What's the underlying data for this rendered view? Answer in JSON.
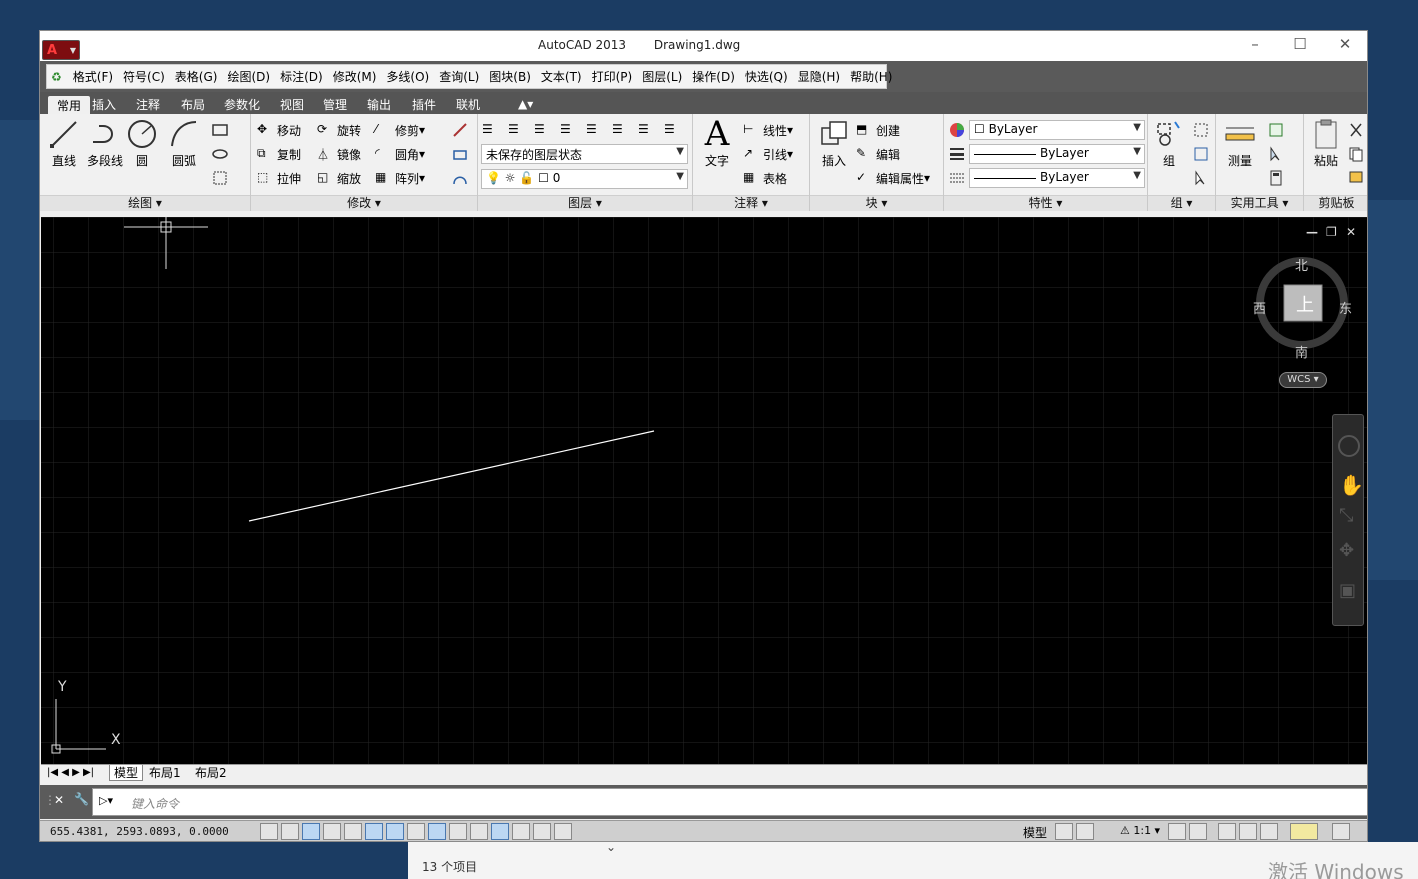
{
  "titlebar": {
    "app": "AutoCAD 2013",
    "file": "Drawing1.dwg"
  },
  "menu": [
    "格式(F)",
    "符号(C)",
    "表格(G)",
    "绘图(D)",
    "标注(D)",
    "修改(M)",
    "多线(O)",
    "查询(L)",
    "图块(B)",
    "文本(T)",
    "打印(P)",
    "图层(L)",
    "操作(D)",
    "快选(Q)",
    "显隐(H)",
    "帮助(H)"
  ],
  "tabs": [
    "常用",
    "插入",
    "注释",
    "布局",
    "参数化",
    "视图",
    "管理",
    "输出",
    "插件",
    "联机"
  ],
  "ribbon": {
    "draw": {
      "title": "绘图",
      "line": "直线",
      "polyline": "多段线",
      "circle": "圆",
      "arc": "圆弧"
    },
    "modify": {
      "title": "修改",
      "move": "移动",
      "rotate": "旋转",
      "trim": "修剪",
      "copy": "复制",
      "mirror": "镜像",
      "fillet": "圆角",
      "stretch": "拉伸",
      "scale": "缩放",
      "array": "阵列"
    },
    "layers": {
      "title": "图层",
      "state": "未保存的图层状态",
      "current": "0"
    },
    "annotation": {
      "title": "注释",
      "text": "文字",
      "linear": "线性",
      "leader": "引线",
      "table": "表格"
    },
    "block": {
      "title": "块",
      "insert": "插入",
      "create": "创建",
      "edit": "编辑",
      "editattr": "编辑属性"
    },
    "properties": {
      "title": "特性",
      "color": "ByLayer",
      "lineweight": "ByLayer",
      "linetype": "ByLayer"
    },
    "group": {
      "title": "组",
      "group": "组"
    },
    "utilities": {
      "title": "实用工具",
      "measure": "测量"
    },
    "clipboard": {
      "title": "剪贴板",
      "paste": "粘贴"
    }
  },
  "viewcube": {
    "north": "北",
    "south": "南",
    "east": "东",
    "west": "西",
    "top": "上",
    "wcs": "WCS"
  },
  "ucs": {
    "x": "X",
    "y": "Y"
  },
  "layout_tabs": [
    "模型",
    "布局1",
    "布局2"
  ],
  "command": {
    "placeholder": "键入命令"
  },
  "status": {
    "coords": "655.4381,  2593.0893, 0.0000",
    "model": "模型",
    "scale": "1:1"
  },
  "explorer": {
    "count": "13 个项目"
  },
  "watermark": "激活 Windows",
  "colors": {
    "canvas": "#000000",
    "grid": "#2a2a2a",
    "ribbon": "#f1f1f1",
    "accent": "#7d0d10"
  }
}
